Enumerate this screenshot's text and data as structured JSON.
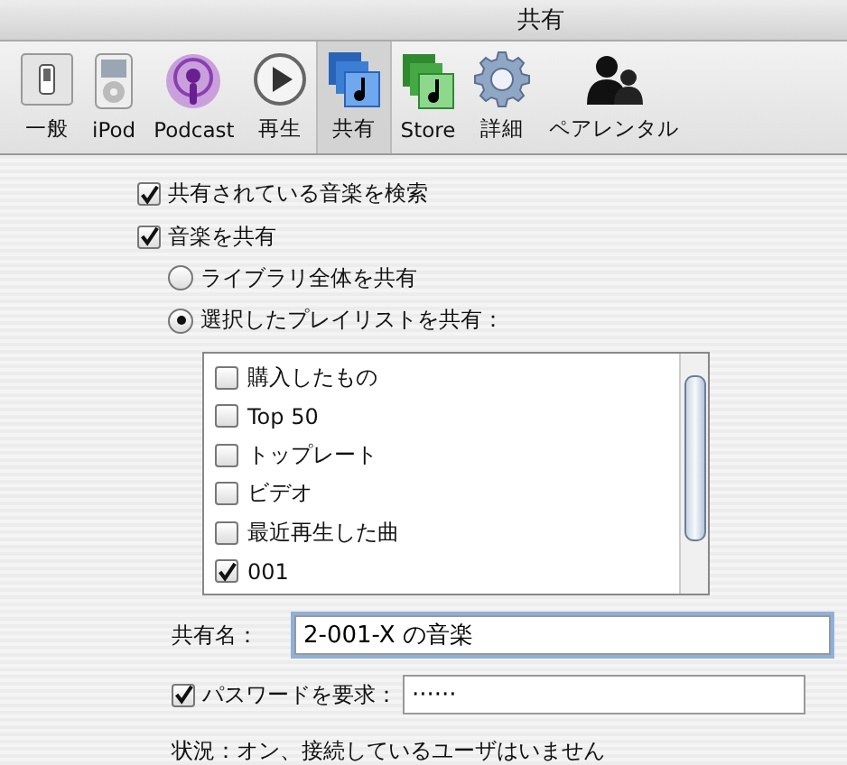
{
  "window": {
    "title": "共有"
  },
  "toolbar": [
    {
      "label": "一般",
      "selected": false
    },
    {
      "label": "iPod",
      "selected": false
    },
    {
      "label": "Podcast",
      "selected": false
    },
    {
      "label": "再生",
      "selected": false
    },
    {
      "label": "共有",
      "selected": true
    },
    {
      "label": "Store",
      "selected": false
    },
    {
      "label": "詳細",
      "selected": false
    },
    {
      "label": "ペアレンタル",
      "selected": false
    }
  ],
  "options": [
    {
      "label": "共有されている音楽を検索",
      "checked": true
    },
    {
      "label": "音楽を共有",
      "checked": true
    }
  ],
  "share_mode": [
    {
      "label": "ライブラリ全体を共有",
      "selected": false
    },
    {
      "label": "選択したプレイリストを共有：",
      "selected": true
    }
  ],
  "playlists": [
    {
      "label": "購入したもの",
      "checked": false
    },
    {
      "label": "Top 50",
      "checked": false
    },
    {
      "label": "トップレート",
      "checked": false
    },
    {
      "label": "ビデオ",
      "checked": false
    },
    {
      "label": "最近再生した曲",
      "checked": false
    },
    {
      "label": "001",
      "checked": true
    }
  ],
  "share_name": {
    "label": "共有名：",
    "value": "2-001-X の音楽"
  },
  "password": {
    "label": "パスワードを要求：",
    "checked": true,
    "value": "······"
  },
  "status": "状況：オン、接続しているユーザはいません"
}
